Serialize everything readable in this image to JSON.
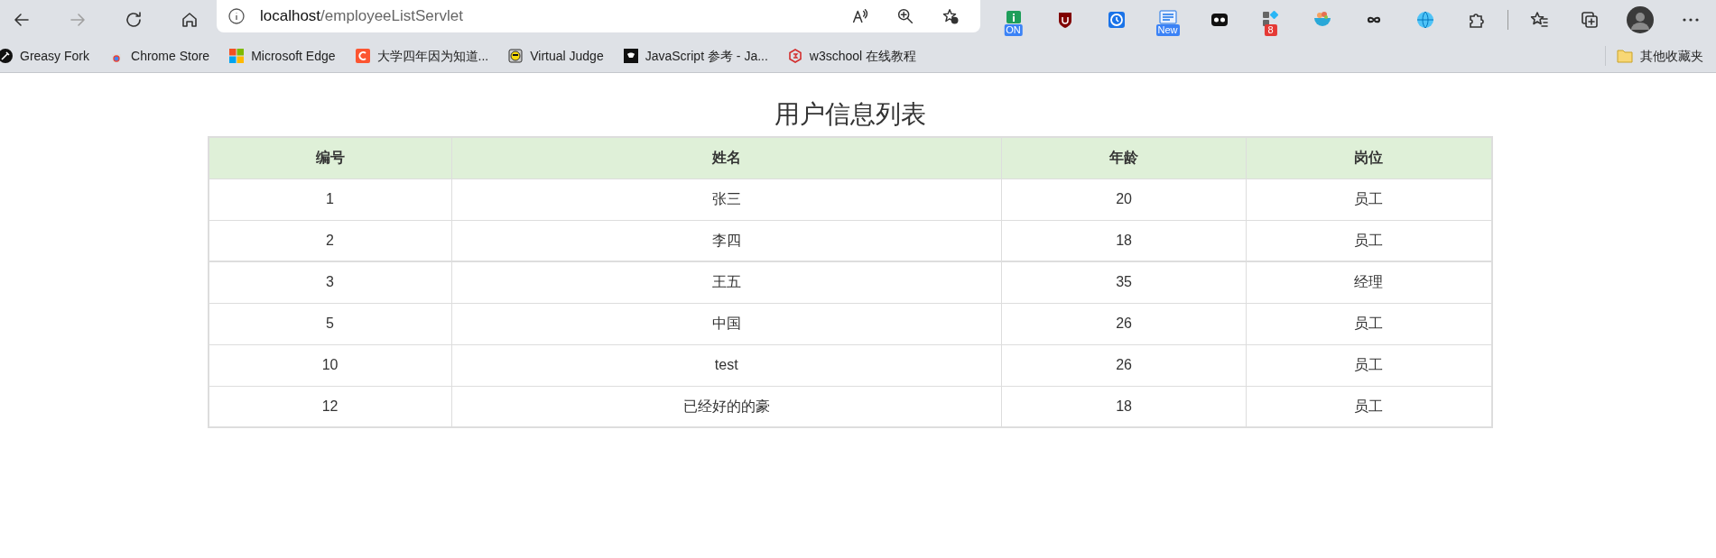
{
  "toolbar": {
    "nav_buttons": [
      {
        "kind": "back",
        "disabled": false
      },
      {
        "kind": "forward",
        "disabled": true
      },
      {
        "kind": "reload",
        "disabled": false
      },
      {
        "kind": "home",
        "disabled": false
      }
    ],
    "address": {
      "host": "localhost",
      "path": "/employeeListServlet"
    },
    "address_actions": [
      {
        "kind": "read-aloud"
      },
      {
        "kind": "zoom"
      },
      {
        "kind": "add-favorite"
      }
    ],
    "extensions": [
      {
        "kind": "info",
        "badge": "ON"
      },
      {
        "kind": "shield"
      },
      {
        "kind": "clock"
      },
      {
        "kind": "news",
        "badge": "New"
      },
      {
        "kind": "cassette"
      },
      {
        "kind": "apps",
        "badge": "8"
      },
      {
        "kind": "bowl"
      },
      {
        "kind": "infinity"
      },
      {
        "kind": "globe"
      },
      {
        "kind": "puzzle"
      }
    ],
    "actions": [
      {
        "kind": "favorites"
      },
      {
        "kind": "collections"
      },
      {
        "kind": "avatar"
      },
      {
        "kind": "more"
      }
    ]
  },
  "bookmarks": [
    {
      "kind": "greasy",
      "label": "Greasy Fork"
    },
    {
      "kind": "chrome",
      "label": "Chrome Store"
    },
    {
      "kind": "microsoft",
      "label": "Microsoft Edge"
    },
    {
      "kind": "c",
      "label": "大学四年因为知道..."
    },
    {
      "kind": "vj",
      "label": "Virtual Judge"
    },
    {
      "kind": "js",
      "label": "JavaScript 参考 - Ja..."
    },
    {
      "kind": "w3",
      "label": "w3school 在线教程"
    }
  ],
  "other_favorites": {
    "label": "其他收藏夹"
  },
  "page": {
    "title": "用户信息列表",
    "table": {
      "columns": [
        "编号",
        "姓名",
        "年龄",
        "岗位"
      ],
      "rows": [
        [
          "1",
          "张三",
          "20",
          "员工"
        ],
        [
          "2",
          "李四",
          "18",
          "员工"
        ],
        [
          "3",
          "王五",
          "35",
          "经理"
        ],
        [
          "5",
          "中国",
          "26",
          "员工"
        ],
        [
          "10",
          "test",
          "26",
          "员工"
        ],
        [
          "12",
          "已经好的的豪",
          "18",
          "员工"
        ]
      ]
    }
  }
}
